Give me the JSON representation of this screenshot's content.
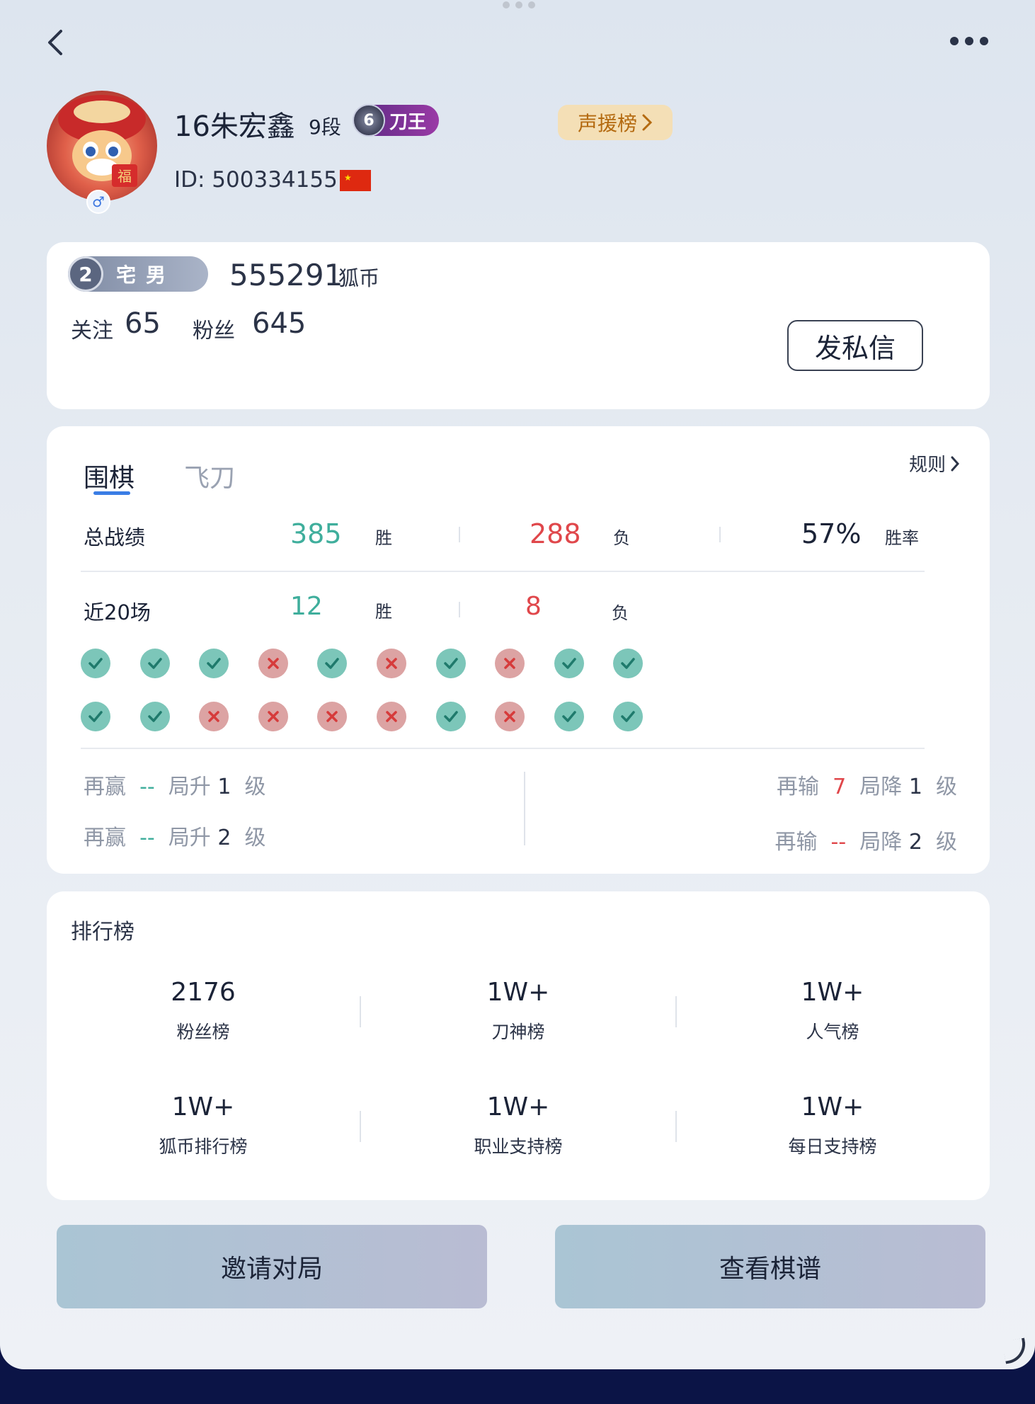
{
  "header": {
    "back_icon": "chevron-left-icon",
    "more_icon": "more-dots-icon"
  },
  "profile": {
    "name": "16朱宏鑫",
    "rank": "9段",
    "medal_level": "6",
    "medal_title": "刀王",
    "support_board": "声援榜",
    "id_text": "ID: 500334155",
    "gender_symbol": "♂",
    "flag": "china-flag"
  },
  "summary": {
    "title_level": "2",
    "title_name": "宅男",
    "coins": "555291",
    "coins_unit": "狐币",
    "follow_label": "关注",
    "follow_count": "65",
    "fans_label": "粉丝",
    "fans_count": "645",
    "message_button": "发私信"
  },
  "record": {
    "tabs": [
      "围棋",
      "飞刀"
    ],
    "active_tab": "围棋",
    "rules_link": "规则",
    "total_label": "总战绩",
    "total_wins": "385",
    "win_label": "胜",
    "total_losses": "288",
    "loss_label": "负",
    "win_rate": "57%",
    "win_rate_label": "胜率",
    "recent_label": "近20场",
    "recent_wins": "12",
    "recent_losses": "8",
    "recent_results": [
      [
        "win",
        "win",
        "win",
        "loss",
        "win",
        "loss",
        "win",
        "loss",
        "win",
        "win"
      ],
      [
        "win",
        "win",
        "loss",
        "loss",
        "loss",
        "loss",
        "win",
        "loss",
        "win",
        "win"
      ]
    ],
    "promote": {
      "prefix": "再赢",
      "games1": "--",
      "mid": "局升",
      "level1": "1",
      "games2": "--",
      "level2": "2",
      "suffix": "级"
    },
    "demote": {
      "prefix": "再输",
      "games1": "7",
      "mid": "局降",
      "level1": "1",
      "games2": "--",
      "level2": "2",
      "suffix": "级"
    }
  },
  "rankings": {
    "title": "排行榜",
    "items": [
      {
        "value": "2176",
        "name": "粉丝榜"
      },
      {
        "value": "1W+",
        "name": "刀神榜"
      },
      {
        "value": "1W+",
        "name": "人气榜"
      },
      {
        "value": "1W+",
        "name": "狐币排行榜"
      },
      {
        "value": "1W+",
        "name": "职业支持榜"
      },
      {
        "value": "1W+",
        "name": "每日支持榜"
      }
    ]
  },
  "actions": {
    "invite": "邀请对局",
    "view_records": "查看棋谱"
  },
  "colors": {
    "win": "#3fae9c",
    "loss": "#e0474b",
    "accent": "#3a7de5",
    "background": "#0b1446"
  }
}
